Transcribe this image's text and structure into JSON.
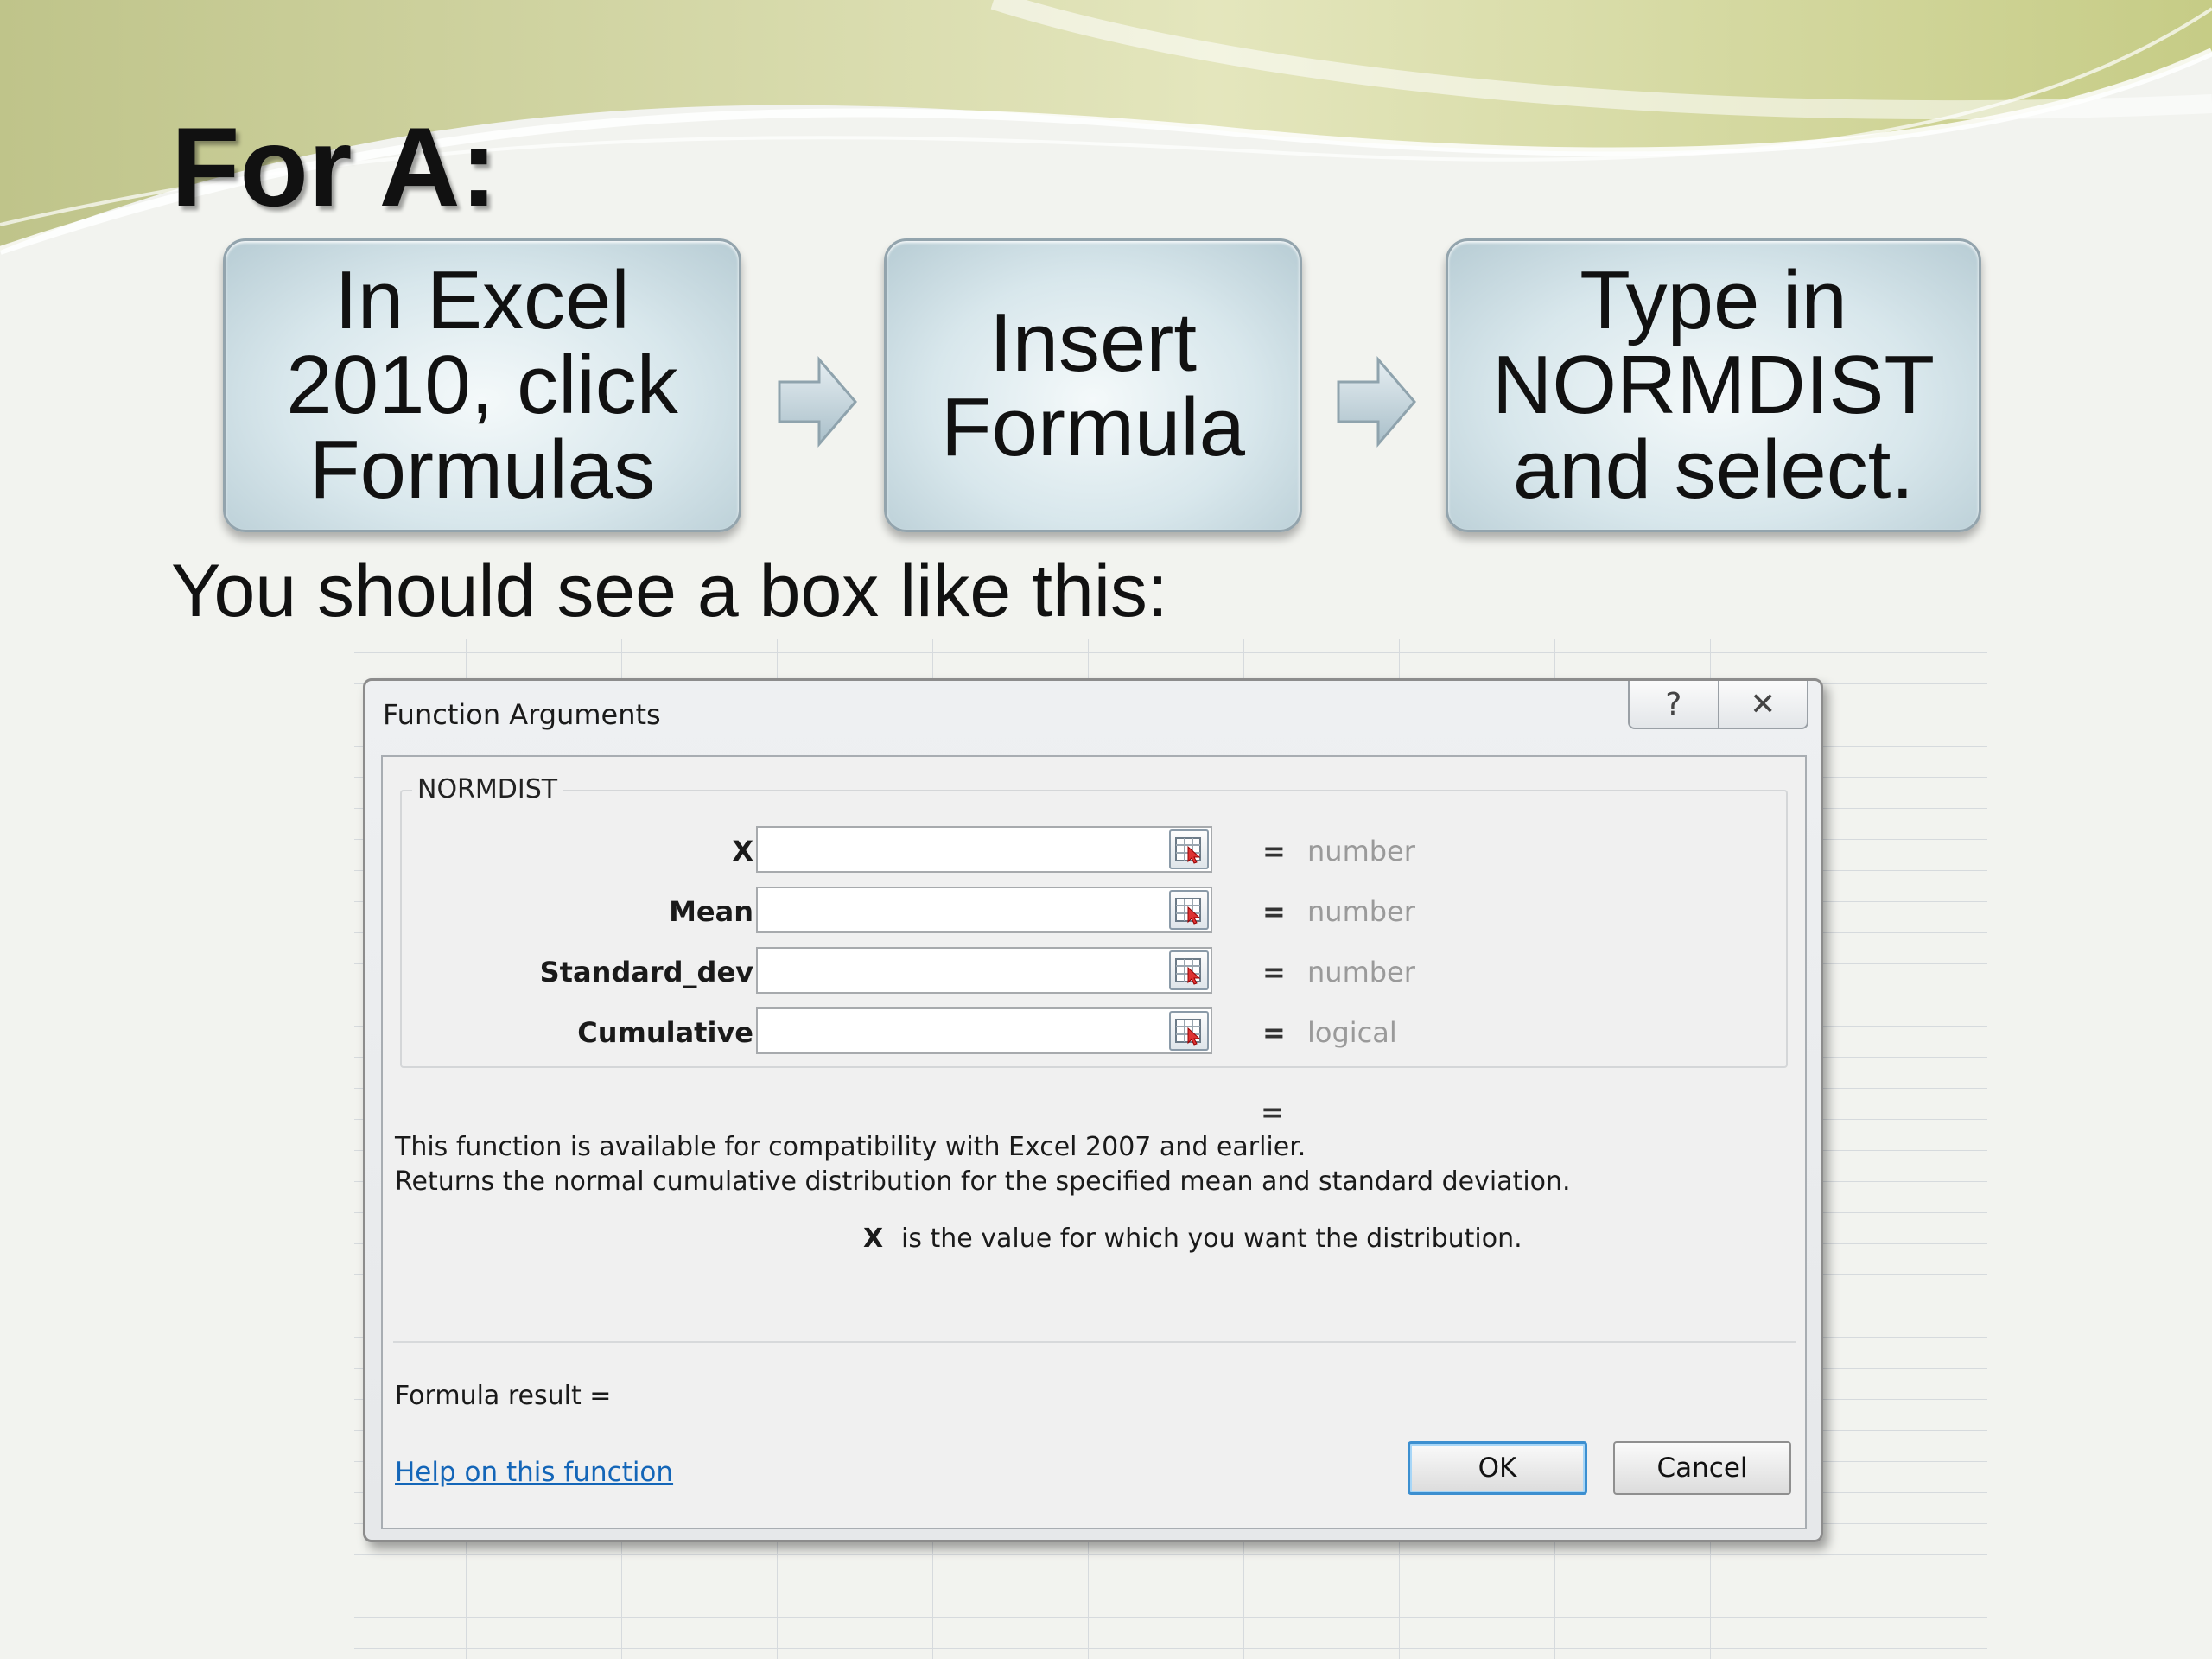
{
  "slide": {
    "title": "For A:",
    "steps": [
      {
        "lines": [
          "In Excel",
          "2010, click",
          "Formulas"
        ]
      },
      {
        "lines": [
          "Insert",
          "Formula"
        ]
      },
      {
        "lines": [
          "Type in",
          "NORMDIST",
          "and select."
        ]
      }
    ],
    "intro": "You should see a box like this:"
  },
  "dialog": {
    "title": "Function Arguments",
    "help_glyph": "?",
    "close_glyph": "✕",
    "function_name": "NORMDIST",
    "args": [
      {
        "label": "X",
        "value": "",
        "hint": "number"
      },
      {
        "label": "Mean",
        "value": "",
        "hint": "number"
      },
      {
        "label": "Standard_dev",
        "value": "",
        "hint": "number"
      },
      {
        "label": "Cumulative",
        "value": "",
        "hint": "logical"
      }
    ],
    "equals": "=",
    "description_line1": "This function is available for compatibility with Excel 2007 and earlier.",
    "description_line2": "Returns the normal cumulative distribution for the specified mean and standard deviation.",
    "arg_help_name": "X",
    "arg_help_text": "is the value for which you want the distribution.",
    "formula_result": "Formula result =",
    "help_link": "Help on this function",
    "ok_label": "OK",
    "cancel_label": "Cancel"
  },
  "colors": {
    "accent_wave": "#c9cf8a",
    "link": "#1466b8",
    "ok_border": "#3c8fd0",
    "hint_text": "#9a9a9a"
  }
}
